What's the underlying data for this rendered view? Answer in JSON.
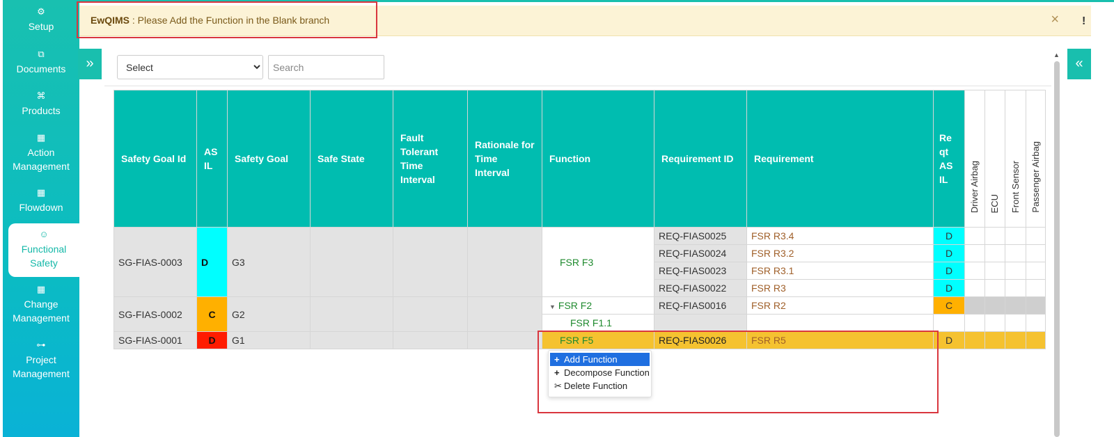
{
  "sidebar": {
    "items": [
      {
        "label": "Setup",
        "icon": "gears-icon"
      },
      {
        "label": "Documents",
        "icon": "documents-icon"
      },
      {
        "label": "Products",
        "icon": "products-icon"
      },
      {
        "label": "Action\nManagement",
        "icon": "building-icon"
      },
      {
        "label": "Flowdown",
        "icon": "building-icon"
      },
      {
        "label": "Functional\nSafety",
        "icon": "functional-safety-icon"
      },
      {
        "label": "Change\nManagement",
        "icon": "building-icon"
      },
      {
        "label": "Project\nManagement",
        "icon": "sitemap-icon"
      }
    ]
  },
  "alert": {
    "app": "EwQIMS",
    "message": " : Please Add the Function in the Blank branch",
    "close": "×"
  },
  "header_badge": "!",
  "toggles": {
    "left": "»",
    "right": "«"
  },
  "filters": {
    "select_value": "Select",
    "search_placeholder": "Search"
  },
  "table": {
    "columns": [
      "Safety Goal Id",
      "ASIL",
      "Safety Goal",
      "Safe State",
      "Fault Tolerant Time Interval",
      "Rationale for Time Interval",
      "Function",
      "Requirement ID",
      "Requirement",
      "Reqt ASIL"
    ],
    "components": [
      "Driver Airbag",
      "ECU",
      "Front Sensor",
      "Passenger Airbag"
    ],
    "goals": [
      {
        "id": "SG-FIAS-0003",
        "asil": "D",
        "goal": "G3",
        "function": "FSR F3",
        "requirements": [
          {
            "rid": "REQ-FIAS0025",
            "req": "FSR R3.4",
            "asil": "D"
          },
          {
            "rid": "REQ-FIAS0024",
            "req": "FSR R3.2",
            "asil": "D"
          },
          {
            "rid": "REQ-FIAS0023",
            "req": "FSR R3.1",
            "asil": "D"
          },
          {
            "rid": "REQ-FIAS0022",
            "req": "FSR R3",
            "asil": "D"
          }
        ]
      },
      {
        "id": "SG-FIAS-0002",
        "asil": "C",
        "goal": "G2",
        "function": "FSR F2",
        "subfunction": "FSR F1.1",
        "requirements": [
          {
            "rid": "REQ-FIAS0016",
            "req": "FSR R2",
            "asil": "C"
          }
        ]
      },
      {
        "id": "SG-FIAS-0001",
        "asil": "D",
        "goal": "G1",
        "function": "FSR F5",
        "requirements": [
          {
            "rid": "REQ-FIAS0026",
            "req": "FSR R5",
            "asil": "D"
          }
        ]
      }
    ]
  },
  "context_menu": {
    "items": [
      {
        "icon": "+",
        "label": "Add Function"
      },
      {
        "icon": "+",
        "label": "Decompose Function"
      },
      {
        "icon": "✂",
        "label": "Delete Function"
      }
    ]
  },
  "colors": {
    "teal": "#00bdb0",
    "asil_d": "#00ffff",
    "asil_c": "#ffb000",
    "asil_d_alt": "#ff1c00",
    "selected_row": "#f5c230",
    "highlight_border": "#d9363e"
  }
}
